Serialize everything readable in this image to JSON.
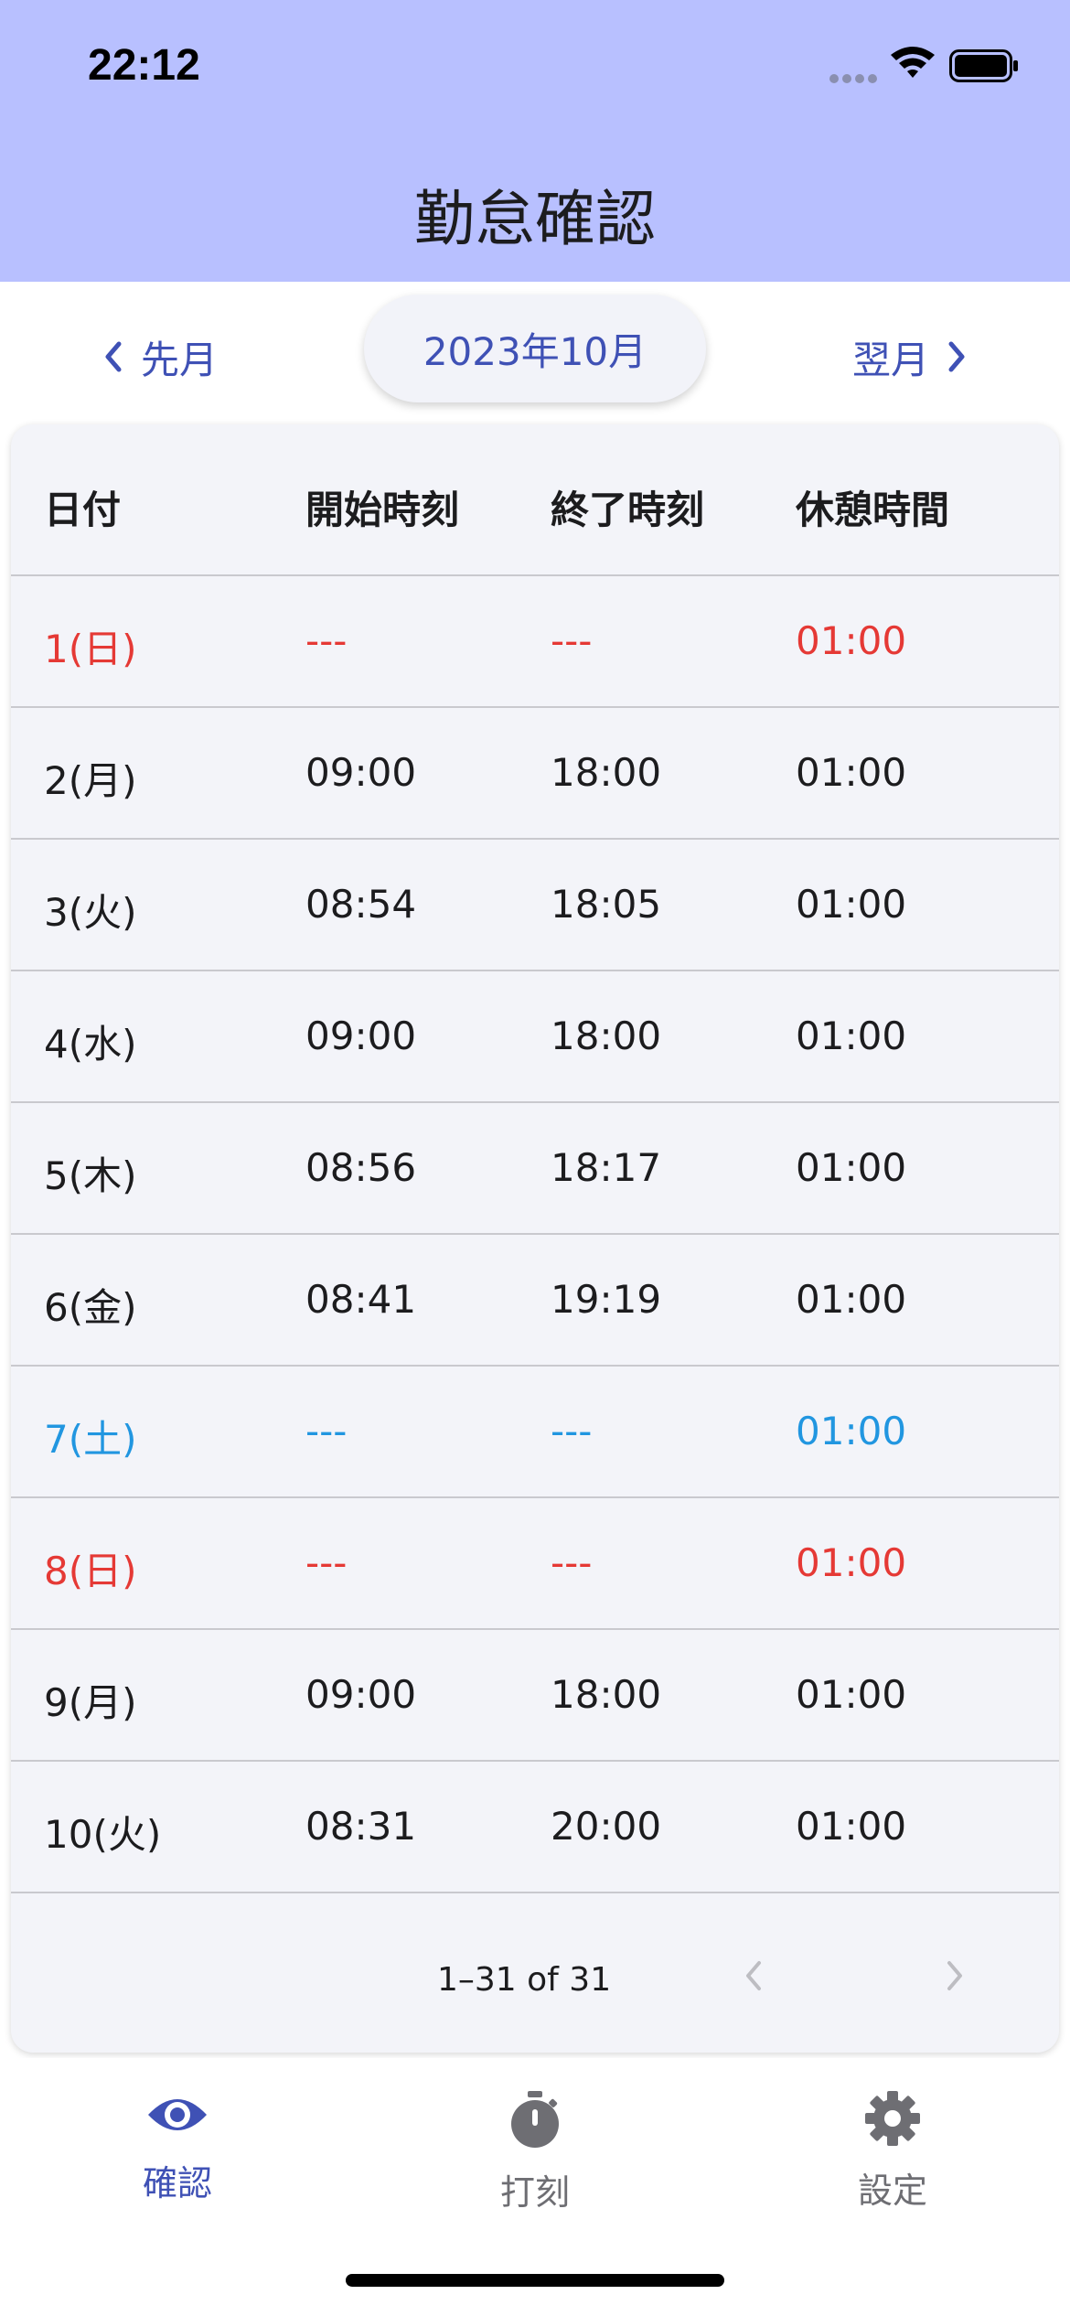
{
  "status": {
    "time": "22:12"
  },
  "header": {
    "title": "勤怠確認"
  },
  "month_nav": {
    "prev_label": "先月",
    "current_month": "2023年10月",
    "next_label": "翌月"
  },
  "table": {
    "headers": [
      "日付",
      "開始時刻",
      "終了時刻",
      "休憩時間"
    ],
    "rows": [
      {
        "date": "1(日)",
        "start": "---",
        "end": "---",
        "break": "01:00",
        "type": "sun"
      },
      {
        "date": "2(月)",
        "start": "09:00",
        "end": "18:00",
        "break": "01:00",
        "type": "weekday"
      },
      {
        "date": "3(火)",
        "start": "08:54",
        "end": "18:05",
        "break": "01:00",
        "type": "weekday"
      },
      {
        "date": "4(水)",
        "start": "09:00",
        "end": "18:00",
        "break": "01:00",
        "type": "weekday"
      },
      {
        "date": "5(木)",
        "start": "08:56",
        "end": "18:17",
        "break": "01:00",
        "type": "weekday"
      },
      {
        "date": "6(金)",
        "start": "08:41",
        "end": "19:19",
        "break": "01:00",
        "type": "weekday"
      },
      {
        "date": "7(土)",
        "start": "---",
        "end": "---",
        "break": "01:00",
        "type": "sat"
      },
      {
        "date": "8(日)",
        "start": "---",
        "end": "---",
        "break": "01:00",
        "type": "sun"
      },
      {
        "date": "9(月)",
        "start": "09:00",
        "end": "18:00",
        "break": "01:00",
        "type": "weekday"
      },
      {
        "date": "10(火)",
        "start": "08:31",
        "end": "20:00",
        "break": "01:00",
        "type": "weekday"
      }
    ],
    "pagination": "1–31 of 31"
  },
  "tabs": [
    {
      "label": "確認",
      "icon": "eye-icon",
      "active": true
    },
    {
      "label": "打刻",
      "icon": "stopwatch-icon",
      "active": false
    },
    {
      "label": "設定",
      "icon": "gear-icon",
      "active": false
    }
  ],
  "colors": {
    "header_bg": "#b8c0ff",
    "accent": "#3f51b5",
    "sunday": "#e53935",
    "saturday": "#2196e0"
  }
}
